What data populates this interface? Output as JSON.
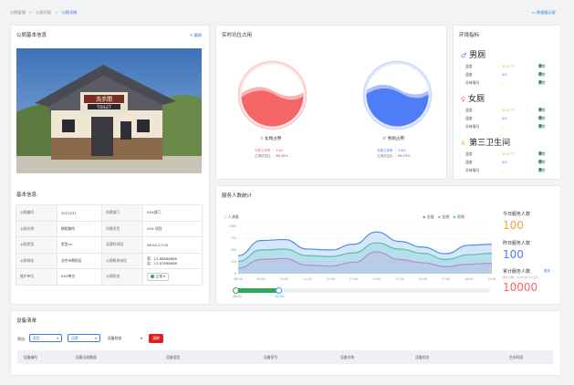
{
  "breadcrumb": {
    "items": [
      "公厕管理",
      "公厕列表",
      "公厕详情"
    ]
  },
  "top_action": "数据展示屏",
  "basic_card": {
    "title": "公厕基本信息",
    "edit_label": "编辑",
    "section_label": "基本信息:"
  },
  "info_table": [
    [
      "公厕编号",
      "1027431",
      "所属部门",
      "XXX部门"
    ],
    [
      "公厕名称",
      "朝阳路所",
      "所属项目",
      "XXX 项目"
    ],
    [
      "公厕类型",
      "类型xx",
      "运营时间段",
      "08:00-17:00"
    ],
    [
      "公厕地址",
      "北京市朝阳区",
      "公厕联系电话",
      "男：12.88888888\n女：12.87888888"
    ],
    [
      "维护单位",
      "XXX单位",
      "公厕状态",
      "正常"
    ]
  ],
  "realtime_card": {
    "title": "实时坑位占用",
    "female": {
      "label": "女厕占用",
      "line1_a": "总数占用率",
      "line1_b": "5/84",
      "line2_a": "占用坑位比",
      "line2_b": "86.45%",
      "color": "#f56565",
      "fill": 0.55
    },
    "male": {
      "label": "男厕占用",
      "line1_a": "总数占用率",
      "line1_b": "5/84",
      "line2_a": "占用坑位比",
      "line2_b": "86.33%",
      "color": "#4f7cf7",
      "fill": 0.58
    }
  },
  "env_card": {
    "title": "环境指标",
    "groups": [
      {
        "name": "男厕",
        "rows": [
          [
            "温度",
            "30.4 ℃",
            "正常"
          ],
          [
            "湿度",
            "4%",
            "正常"
          ],
          [
            "异味情况",
            "--",
            "正常"
          ]
        ]
      },
      {
        "name": "女厕",
        "rows": [
          [
            "温度",
            "30.4 ℃",
            "正常"
          ],
          [
            "湿度",
            "4%",
            "正常"
          ],
          [
            "异味情况",
            "--",
            "正常"
          ]
        ]
      },
      {
        "name": "第三卫生间",
        "rows": [
          [
            "温度",
            "30.4 ℃",
            "正常"
          ],
          [
            "湿度",
            "4%",
            "正常"
          ],
          [
            "异味情况",
            "--",
            "正常"
          ]
        ]
      }
    ]
  },
  "service_card": {
    "title": "服务人数统计",
    "unit_label": "人流量",
    "legend": [
      "总量",
      "女厕",
      "男厕"
    ],
    "today_label": "今日服务人数",
    "today_value": "100",
    "yesterday_label": "昨日服务人数",
    "yesterday_value": "100",
    "total_label": "累计服务人数",
    "total_more": "更多",
    "total_note": "统计日期：2018-02-01 至今",
    "total_value": "10000",
    "slider_start": "08:00",
    "slider_end": "10:00"
  },
  "chart_data": {
    "type": "area",
    "x": [
      "08:00",
      "09:00",
      "10:00",
      "11:00",
      "12:00",
      "13:00",
      "14:00",
      "15:00",
      "16:00",
      "17:00",
      "18:00",
      "19:00"
    ],
    "ylim": [
      0,
      1000
    ],
    "yticks": [
      0,
      250,
      500,
      750,
      1000
    ],
    "series": [
      {
        "name": "总量",
        "color": "#4a90e2",
        "values": [
          380,
          700,
          720,
          520,
          500,
          620,
          880,
          680,
          560,
          420,
          600,
          620
        ]
      },
      {
        "name": "女厕",
        "color": "#d07fdc",
        "values": [
          120,
          300,
          320,
          180,
          160,
          240,
          460,
          300,
          230,
          150,
          200,
          220
        ]
      },
      {
        "name": "男厕",
        "color": "#4bc3b8",
        "values": [
          260,
          500,
          520,
          380,
          360,
          440,
          650,
          520,
          430,
          300,
          400,
          430
        ]
      }
    ]
  },
  "device_card": {
    "title": "设备清单",
    "filter_label": "筛选:",
    "filters": [
      "类型",
      "品牌",
      "设备状态"
    ],
    "clear_label": "清除",
    "columns": [
      "设备编号",
      "设备当前数据",
      "设备类型",
      "设备型号",
      "设备名称",
      "设备状态",
      "空闲时段"
    ]
  },
  "colors": {
    "accent": "#3a7bd5",
    "orange": "#f4a13a",
    "green": "#2ea95a",
    "red": "#e02020"
  }
}
